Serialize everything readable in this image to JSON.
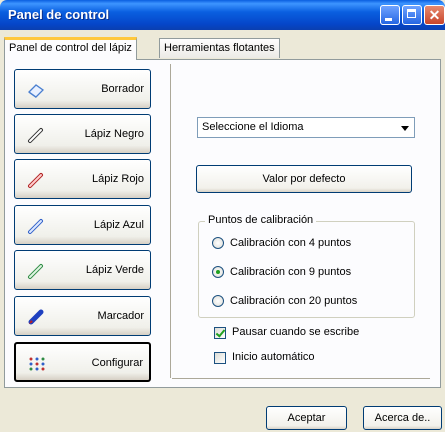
{
  "window": {
    "title": "Panel de control"
  },
  "tabs": [
    {
      "label": "Panel de control del lápiz",
      "active": true
    },
    {
      "label": "Herramientas flotantes",
      "active": false
    }
  ],
  "tools": [
    {
      "label": "Borrador",
      "icon": "eraser-icon",
      "color": "#4a7fd0"
    },
    {
      "label": "Lápiz Negro",
      "icon": "black-pen-icon",
      "color": "#333333"
    },
    {
      "label": "Lápiz Rojo",
      "icon": "red-pen-icon",
      "color": "#d03030"
    },
    {
      "label": "Lápiz Azul",
      "icon": "blue-pen-icon",
      "color": "#2f5fc8"
    },
    {
      "label": "Lápiz Verde",
      "icon": "green-pen-icon",
      "color": "#2ea043"
    },
    {
      "label": "Marcador",
      "icon": "marker-icon",
      "color": "#1e40c0"
    },
    {
      "label": "Configurar",
      "icon": "settings-dots-icon",
      "color": "#c03030"
    }
  ],
  "language": {
    "value": "Seleccione el Idioma"
  },
  "default_button": "Valor por defecto",
  "calibration": {
    "legend": "Puntos de calibración",
    "options": [
      {
        "label": "Calibración con 4 puntos",
        "selected": false
      },
      {
        "label": "Calibración con 9 puntos",
        "selected": true
      },
      {
        "label": "Calibración con 20 puntos",
        "selected": false
      }
    ]
  },
  "checkboxes": [
    {
      "label": "Pausar cuando se escribe",
      "checked": true
    },
    {
      "label": "Inicio automático",
      "checked": false
    }
  ],
  "footer": {
    "accept": "Aceptar",
    "about": "Acerca de.."
  }
}
